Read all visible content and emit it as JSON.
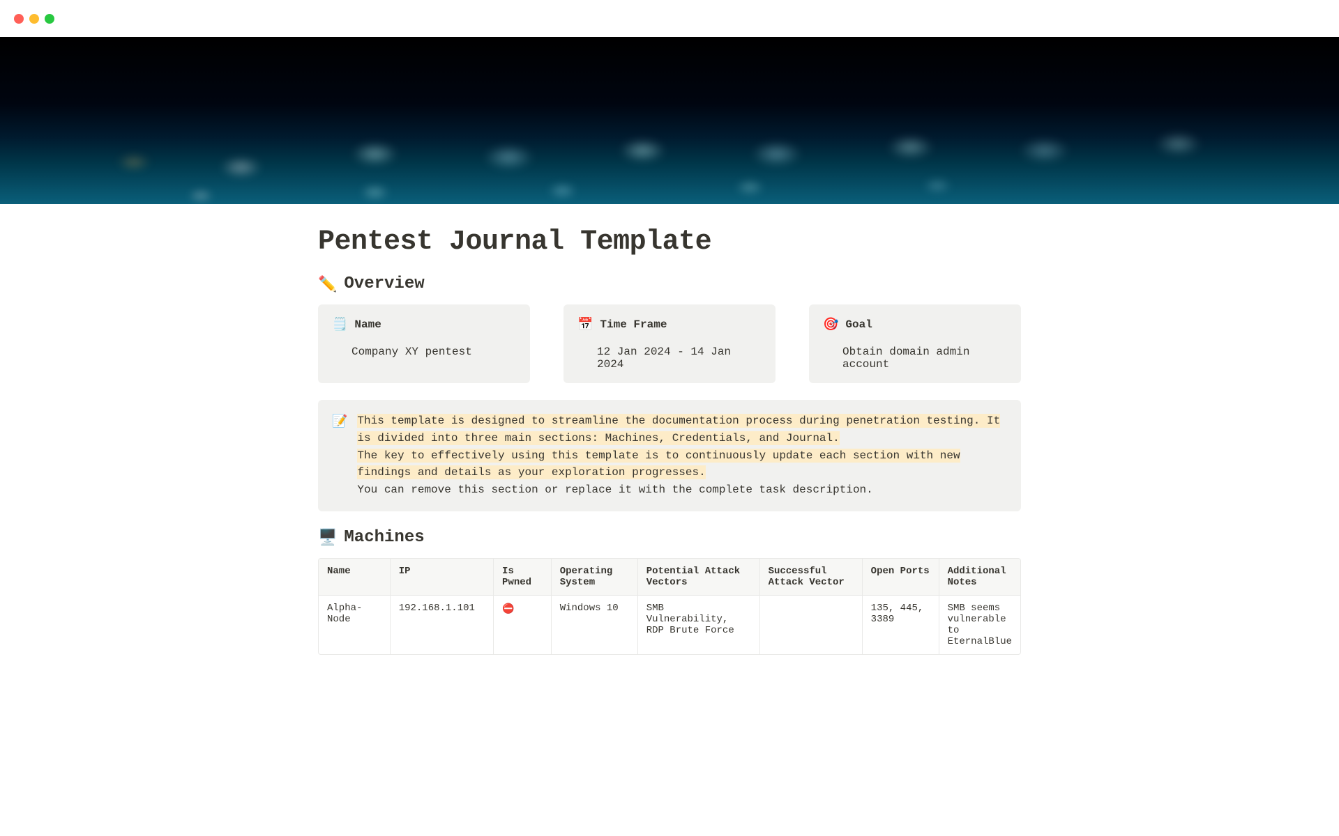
{
  "page": {
    "title": "Pentest Journal Template"
  },
  "overview": {
    "heading": "Overview",
    "icon": "✏️",
    "cards": {
      "name": {
        "icon": "🗒️",
        "label": "Name",
        "value": "Company XY pentest"
      },
      "timeframe": {
        "icon": "📅",
        "label": "Time Frame",
        "value": "12 Jan 2024 - 14 Jan 2024"
      },
      "goal": {
        "icon": "🎯",
        "label": "Goal",
        "value": "Obtain domain admin account"
      }
    }
  },
  "callout": {
    "icon": "📝",
    "line1": "This template is designed to streamline the documentation process during penetration testing. It is divided into three main sections: Machines, Credentials, and Journal.",
    "line2": "The key to effectively using this template is to continuously update each section with new findings and details as your exploration progresses.",
    "line3": "You can remove this section or replace it with the complete task description."
  },
  "machines": {
    "heading": "Machines",
    "icon": "🖥️",
    "columns": {
      "name": "Name",
      "ip": "IP",
      "pwned": "Is Pwned",
      "os": "Operating System",
      "pav": "Potential Attack Vectors",
      "sav": "Successful Attack Vector",
      "ports": "Open Ports",
      "notes": "Additional Notes"
    },
    "rows": [
      {
        "name": "Alpha-Node",
        "ip": "192.168.1.101",
        "pwned": "⛔",
        "os": "Windows 10",
        "pav": "SMB Vulnerability, RDP Brute Force",
        "sav": "",
        "ports": "135, 445, 3389",
        "notes": "SMB seems vulnerable to EternalBlue"
      }
    ]
  }
}
